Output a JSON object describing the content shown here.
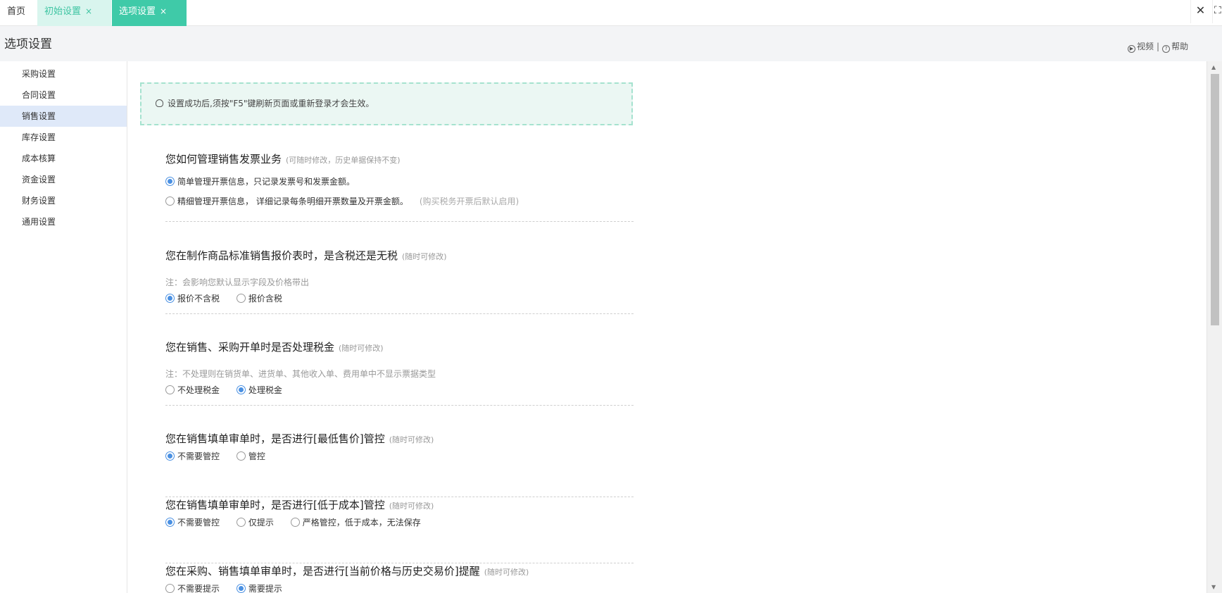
{
  "tabs": [
    {
      "label": "首页"
    },
    {
      "label": "初始设置",
      "close": "×"
    },
    {
      "label": "选项设置",
      "close": "×"
    }
  ],
  "window_controls": {
    "close": "✕",
    "fullscreen": "⛶"
  },
  "page_title": "选项设置",
  "help_links": {
    "video": "视频",
    "separator": "|",
    "help": "帮助"
  },
  "sidebar": {
    "items": [
      {
        "label": "采购设置"
      },
      {
        "label": "合同设置"
      },
      {
        "label": "销售设置",
        "active": true
      },
      {
        "label": "库存设置"
      },
      {
        "label": "成本核算"
      },
      {
        "label": "资金设置"
      },
      {
        "label": "财务设置"
      },
      {
        "label": "通用设置"
      }
    ]
  },
  "tip": "设置成功后,须按\"F5\"键刷新页面或重新登录才会生效。",
  "sections": [
    {
      "question": "您如何管理销售发票业务",
      "note": "(可随时修改，历史单据保持不变)",
      "options": [
        {
          "label": "简单管理开票信息，只记录发票号和发票金额。",
          "checked": true
        },
        {
          "label": "精细管理开票信息， 详细记录每条明细开票数量及开票金额。",
          "checked": false,
          "extra": "(购买税务开票后默认启用)"
        }
      ]
    },
    {
      "question": "您在制作商品标准销售报价表时，是含税还是无税",
      "note": "(随时可修改)",
      "sub": "注：会影响您默认显示字段及价格带出",
      "options": [
        {
          "label": "报价不含税",
          "checked": true
        },
        {
          "label": "报价含税",
          "checked": false
        }
      ]
    },
    {
      "question": "您在销售、采购开单时是否处理税金",
      "note": "(随时可修改)",
      "sub": "注：不处理则在销货单、进货单、其他收入单、费用单中不显示票据类型",
      "options": [
        {
          "label": "不处理税金",
          "checked": false
        },
        {
          "label": "处理税金",
          "checked": true
        }
      ]
    },
    {
      "question": "您在销售填单审单时，是否进行[最低售价]管控",
      "note": "(随时可修改)",
      "options": [
        {
          "label": "不需要管控",
          "checked": true
        },
        {
          "label": "管控",
          "checked": false
        }
      ]
    },
    {
      "question": "您在销售填单审单时，是否进行[低于成本]管控",
      "note": "(随时可修改)",
      "options": [
        {
          "label": "不需要管控",
          "checked": true
        },
        {
          "label": "仅提示",
          "checked": false
        },
        {
          "label": "严格管控，低于成本，无法保存",
          "checked": false
        }
      ]
    },
    {
      "question": "您在采购、销售填单审单时，是否进行[当前价格与历史交易价]提醒",
      "note": "(随时可修改)",
      "options": [
        {
          "label": "不需要提示",
          "checked": false
        },
        {
          "label": "需要提示",
          "checked": true
        }
      ]
    }
  ],
  "colors": {
    "accent": "#3fcaa8",
    "radio": "#4a90e2",
    "sidebar_active": "#dfe9f9"
  }
}
